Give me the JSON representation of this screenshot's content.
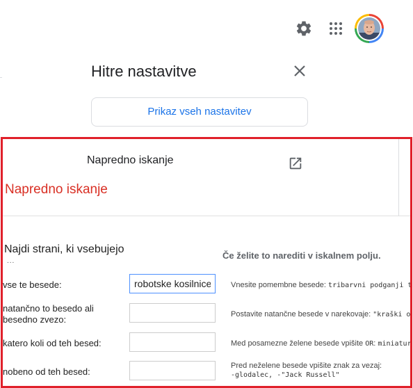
{
  "quick_settings": {
    "title": "Hitre nastavitve",
    "all_settings_button": "Prikaz vseh nastavitev"
  },
  "advanced": {
    "row_label": "Napredno iskanje",
    "heading": "Napredno iskanje",
    "section_title": "Najdi strani, ki vsebujejo",
    "ellipsis": "...",
    "right_title": "Če želite to narediti v iskalnem polju.",
    "fields": [
      {
        "label": "vse te besede:",
        "value": "robotske kosilnice"
      },
      {
        "label": "natančno to besedo ali\nbesedno zvezo:",
        "value": ""
      },
      {
        "label": "katero koli od teh besed:",
        "value": ""
      },
      {
        "label": "nobeno od teh besed:",
        "value": ""
      }
    ],
    "hints": [
      {
        "text": "Vnesite pomembne besede:",
        "code": "tribarvni podganji t"
      },
      {
        "text": "Postavite natančne besede v narekovaje:",
        "code": "\"kraški o"
      },
      {
        "text": "Med posamezne želene besede vpišite",
        "code_inline": "OR",
        "text2": ":",
        "code": "miniatur"
      },
      {
        "text": "Pred neželene besede vpišite znak za vezaj:",
        "code": "-glodalec, -\"Jack Russell\""
      }
    ]
  },
  "icons": {
    "gear": "gear-icon",
    "apps": "apps-grid-icon",
    "close": "close-icon",
    "external": "open-in-new-icon"
  },
  "colors": {
    "highlight_frame": "#e0202a",
    "heading_red": "#d93025",
    "link_blue": "#1a73e8"
  }
}
